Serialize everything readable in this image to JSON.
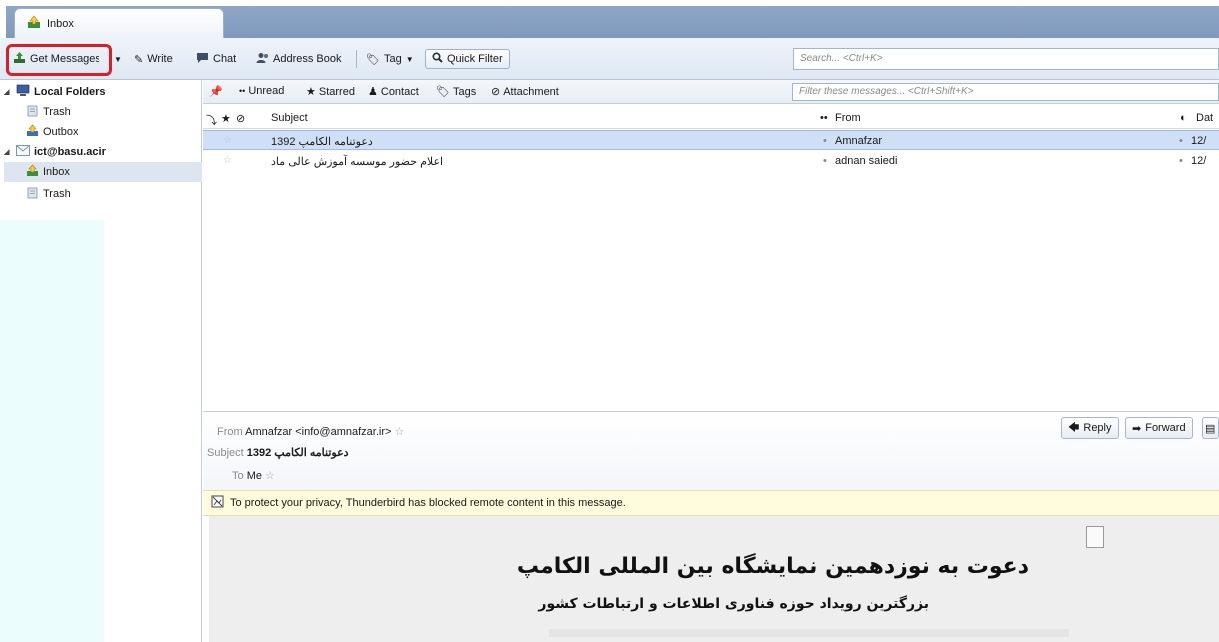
{
  "tabs": [
    {
      "label": "Inbox"
    }
  ],
  "toolbar": {
    "get_messages": "Get Messages",
    "write": "Write",
    "chat": "Chat",
    "address_book": "Address Book",
    "tag": "Tag",
    "quick_filter": "Quick Filter",
    "search_placeholder": "Search... <Ctrl+K>"
  },
  "folders": {
    "local_folders": "Local Folders",
    "trash": "Trash",
    "outbox": "Outbox",
    "account": "ict@basu.acir",
    "inbox": "Inbox",
    "account_trash": "Trash"
  },
  "filterbar": {
    "unread": "Unread",
    "starred": "Starred",
    "contact": "Contact",
    "tags": "Tags",
    "attachment": "Attachment",
    "placeholder": "Filter these messages... <Ctrl+Shift+K>"
  },
  "columns": {
    "subject": "Subject",
    "from": "From",
    "date": "Dat"
  },
  "messages": [
    {
      "subject": "دعوتنامه الکامپ 1392",
      "from": "Amnafzar",
      "date": "12/"
    },
    {
      "subject": "اعلام حضور موسسه آموزش عالی ماد",
      "from": "adnan saiedi",
      "date": "12/"
    }
  ],
  "header": {
    "from_label": "From",
    "from_value": "Amnafzar <info@amnafzar.ir>",
    "subject_label": "Subject",
    "subject_value": "دعوتنامه الکامپ 1392",
    "to_label": "To",
    "to_value": "Me",
    "reply": "Reply",
    "forward": "Forward"
  },
  "notice": "To protect your privacy, Thunderbird has blocked remote content in this message.",
  "body": {
    "title": "دعوت به نوزدهمین نمایشگاه بین المللی الکامپ",
    "subtitle": "بزرگترین رویداد حوزه فناوری اطلاعات و ارتباطات کشور"
  },
  "colors": {
    "highlight": "#d61f26",
    "selection": "#cfe0f6",
    "notice": "#fffbdc"
  }
}
